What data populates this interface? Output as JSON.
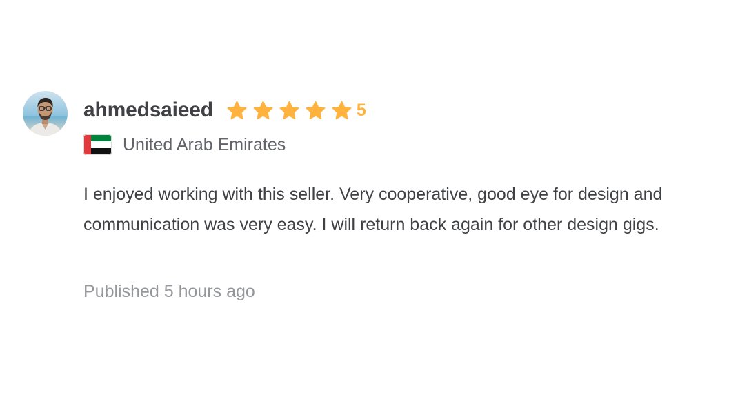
{
  "review": {
    "username": "ahmedsaieed",
    "rating": "5",
    "rating_stars": 5,
    "country": "United Arab Emirates",
    "text": "I enjoyed working with this seller. Very cooperative, good eye for design and communication was very easy. I will return back again for other design gigs.",
    "published": "Published 5 hours ago"
  },
  "colors": {
    "star": "#ffb33e",
    "username": "#404145",
    "secondary_text": "#62646a",
    "muted_text": "#95979d"
  },
  "icons": {
    "avatar": "user-avatar-photo",
    "star": "star-icon",
    "flag": "uae-flag-icon"
  }
}
